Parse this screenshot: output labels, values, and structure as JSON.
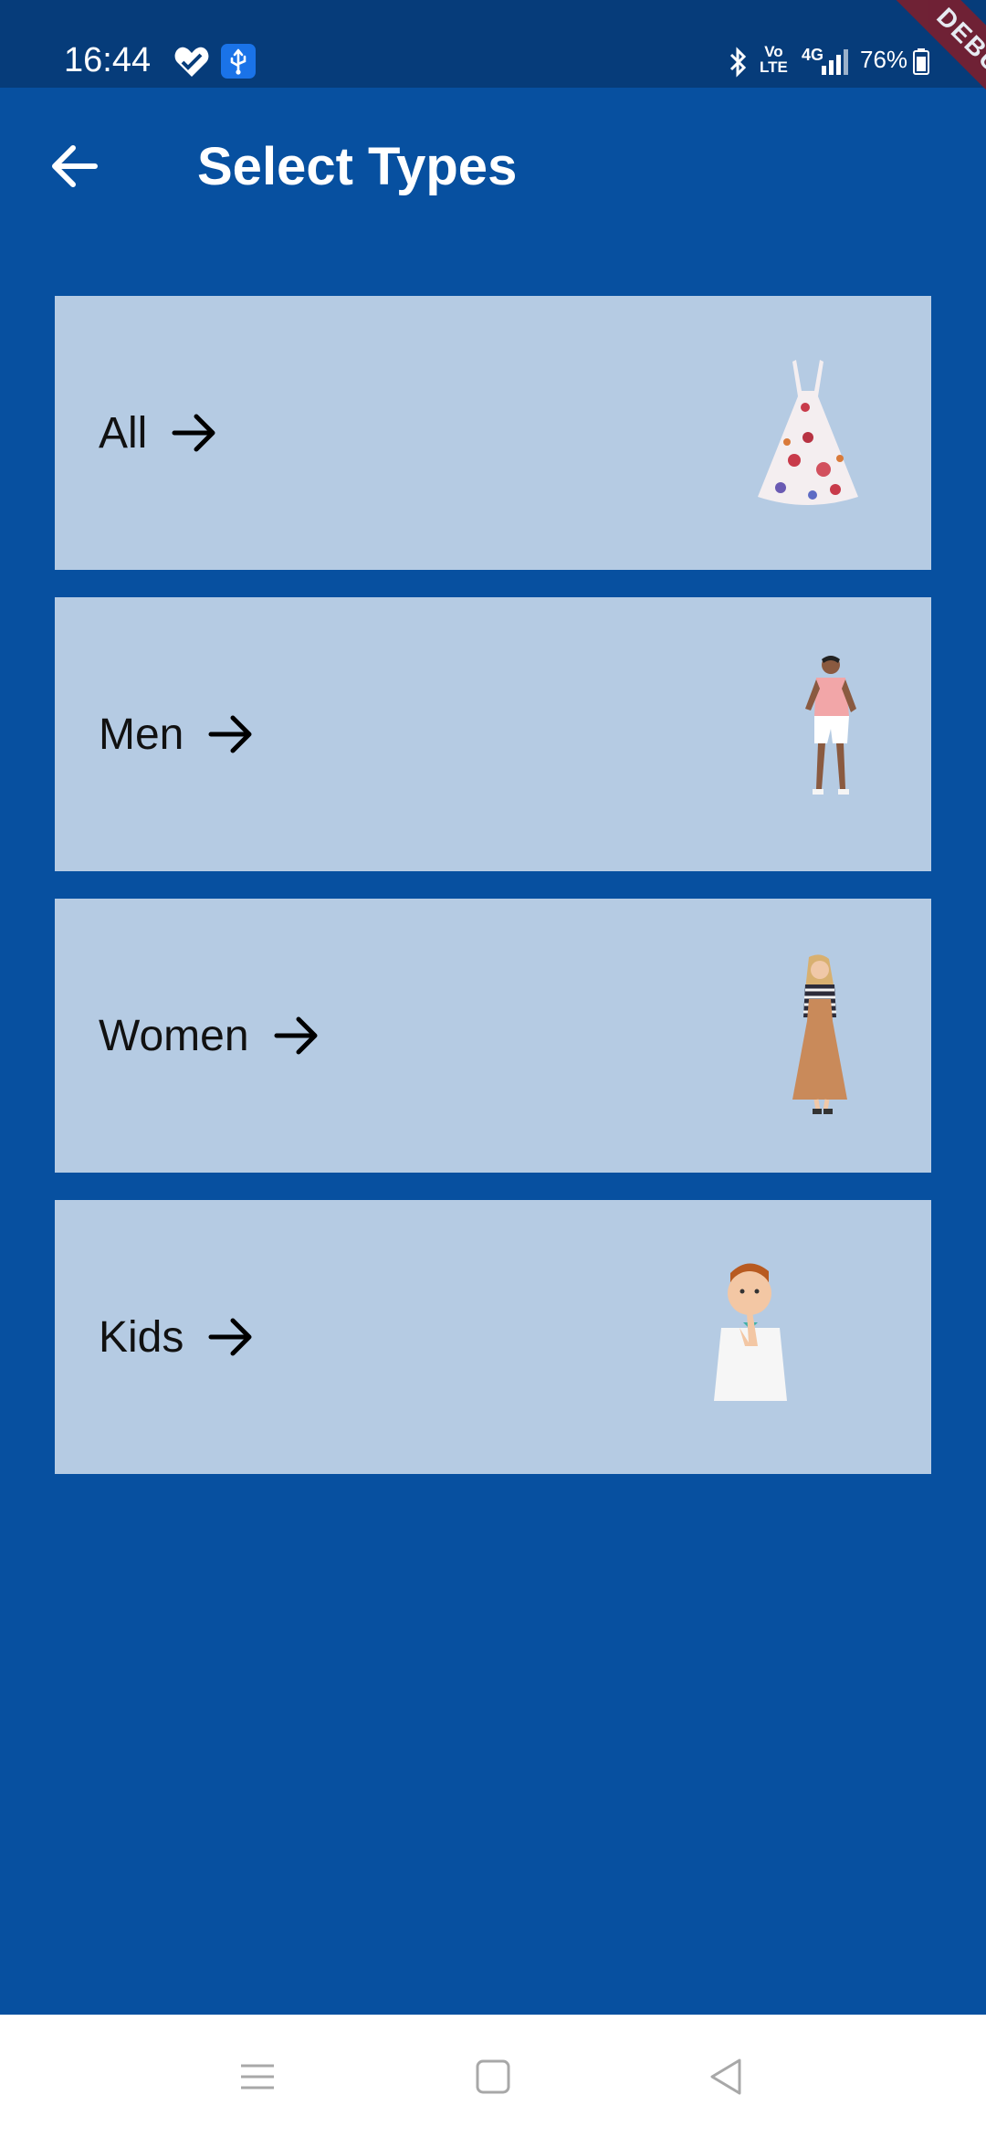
{
  "status_bar": {
    "time": "16:44",
    "network_label": "Vo LTE",
    "volte_top": "Vo",
    "volte_bottom": "LTE",
    "network_type": "4G",
    "battery": "76%",
    "icons": [
      "heart-monitor-icon",
      "usb-icon",
      "bluetooth-icon",
      "signal-icon",
      "battery-icon"
    ]
  },
  "debug_banner": "DEBUG",
  "app_bar": {
    "title": "Select Types",
    "back_icon": "arrow-back-icon"
  },
  "categories": [
    {
      "label": "All",
      "icon": "arrow-forward-icon",
      "image": "floral-dress"
    },
    {
      "label": "Men",
      "icon": "arrow-forward-icon",
      "image": "man-in-pink-shirt"
    },
    {
      "label": "Women",
      "icon": "arrow-forward-icon",
      "image": "woman-in-tan-pinafore"
    },
    {
      "label": "Kids",
      "icon": "arrow-forward-icon",
      "image": "thinking-boy"
    }
  ],
  "navigation_bar": {
    "icons": [
      "menu-icon",
      "home-icon",
      "back-icon"
    ]
  },
  "colors": {
    "background": "#0750a0",
    "status_bar": "#063c7a",
    "card": "#b5cbe3",
    "debug_banner": "#7b1f2e"
  }
}
